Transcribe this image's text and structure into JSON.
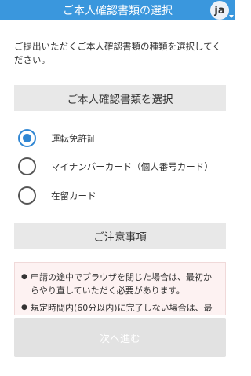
{
  "header": {
    "title": "ご本人確認書類の選択",
    "lang": "ja"
  },
  "intro": "ご提出いただくご本人確認書類の種類を選択してください。",
  "section_select": "ご本人確認書類を選択",
  "options": [
    {
      "label": "運転免許証",
      "checked": true
    },
    {
      "label": "マイナンバーカード（個人番号カード）",
      "checked": false
    },
    {
      "label": "在留カード",
      "checked": false
    }
  ],
  "section_notes": "ご注意事項",
  "notes": [
    "申請の途中でブラウザを閉じた場合は、最初からやり直していただく必要があります。",
    "規定時間内(60分以内)に完了しない場合は、最初"
  ],
  "next_button": "次へ進む",
  "colors": {
    "accent": "#3a97dd",
    "radio": "#2f86d3",
    "notes_bg": "#fdf2f2"
  }
}
